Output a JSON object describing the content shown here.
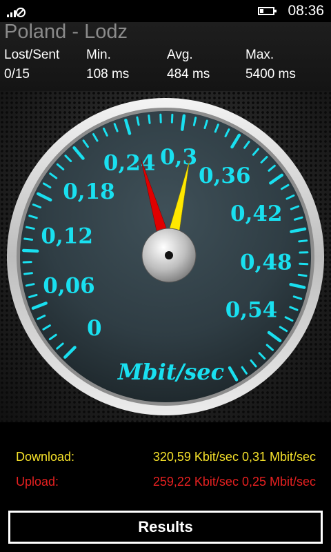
{
  "status_bar": {
    "time": "08:36",
    "battery_level": 0.3
  },
  "header": {
    "location": "Poland - Lodz",
    "stats": [
      {
        "label": "Lost/Sent",
        "value": "0/15"
      },
      {
        "label": "Min.",
        "value": "108 ms"
      },
      {
        "label": "Avg.",
        "value": "484 ms"
      },
      {
        "label": "Max.",
        "value": "5400 ms"
      }
    ]
  },
  "gauge": {
    "unit": "Mbit/sec",
    "scale_min": 0,
    "scale_max": 0.6,
    "tick_labels": [
      "0",
      "0,06",
      "0,12",
      "0,18",
      "0,24",
      "0,3",
      "0,36",
      "0,42",
      "0,48",
      "0,54"
    ],
    "needle_download": 0.31,
    "needle_upload": 0.25,
    "colors": {
      "ticks": "#19e0f0",
      "needle_download": "#ffe800",
      "needle_upload": "#e00000",
      "face": "#33424a"
    }
  },
  "results": {
    "download_label": "Download:",
    "download_value": "320,59 Kbit/sec 0,31 Mbit/sec",
    "upload_label": "Upload:",
    "upload_value": "259,22 Kbit/sec 0,25 Mbit/sec",
    "colors": {
      "download": "#f5e12a",
      "upload": "#e62020"
    }
  },
  "button": {
    "label": "Results"
  }
}
